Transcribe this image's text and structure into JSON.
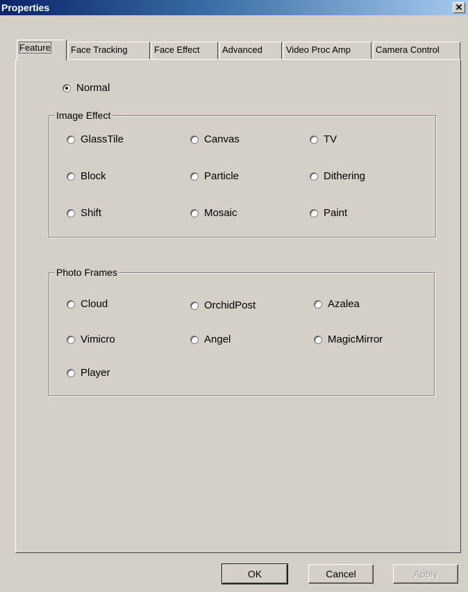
{
  "window": {
    "title": "Properties"
  },
  "tabs": [
    {
      "label": "Feature",
      "active": true
    },
    {
      "label": "Face Tracking"
    },
    {
      "label": "Face Effect"
    },
    {
      "label": "Advanced"
    },
    {
      "label": "Video Proc Amp"
    },
    {
      "label": "Camera Control"
    }
  ],
  "normal": {
    "label": "Normal",
    "checked": true
  },
  "image_effect": {
    "label": "Image Effect",
    "options": [
      "GlassTile",
      "Canvas",
      "TV",
      "Block",
      "Particle",
      "Dithering",
      "Shift",
      "Mosaic",
      "Paint"
    ]
  },
  "photo_frames": {
    "label": "Photo Frames",
    "options": [
      "Cloud",
      "OrchidPost",
      "Azalea",
      "Vimicro",
      "Angel",
      "MagicMirror",
      "Player"
    ]
  },
  "buttons": {
    "ok": "OK",
    "cancel": "Cancel",
    "apply": "Apply"
  }
}
